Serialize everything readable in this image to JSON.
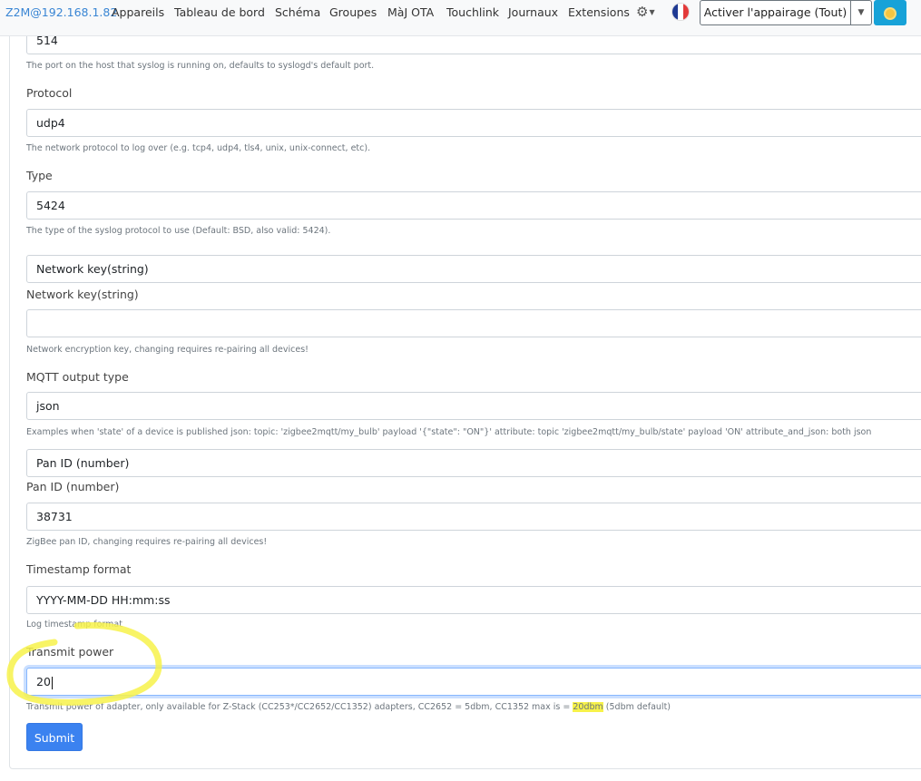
{
  "navbar": {
    "brand": "Z2M@192.168.1.82",
    "links": [
      "Appareils",
      "Tableau de bord",
      "Schéma",
      "Groupes",
      "MàJ OTA",
      "Touchlink",
      "Journaux",
      "Extensions"
    ],
    "pairing_button": "Activer l'appairage (Tout)",
    "flag_colors": [
      "#1f3a93",
      "#ffffff",
      "#e33a3a"
    ],
    "settings_icon": "gear-icon",
    "theme_icon": "sun-icon"
  },
  "form": {
    "port": {
      "value": "514",
      "help": "The port on the host that syslog is running on, defaults to syslogd's default port."
    },
    "protocol": {
      "label": "Protocol",
      "value": "udp4",
      "help": "The network protocol to log over (e.g. tcp4, udp4, tls4, unix, unix-connect, etc)."
    },
    "type": {
      "label": "Type",
      "value": "5424",
      "help": "The type of the syslog protocol to use (Default: BSD, also valid: 5424)."
    },
    "network_key": {
      "selector": "Network key(string)",
      "label": "Network key(string)",
      "value": "",
      "help": "Network encryption key, changing requires re-pairing all devices!"
    },
    "mqtt_output": {
      "label": "MQTT output type",
      "value": "json",
      "help": "Examples when 'state' of a device is published json: topic: 'zigbee2mqtt/my_bulb' payload '{\"state\": \"ON\"}' attribute: topic 'zigbee2mqtt/my_bulb/state' payload 'ON' attribute_and_json: both json"
    },
    "pan_id": {
      "selector": "Pan ID (number)",
      "label": "Pan ID (number)",
      "value": "38731",
      "help": "ZigBee pan ID, changing requires re-pairing all devices!"
    },
    "timestamp": {
      "label": "Timestamp format",
      "value": "YYYY-MM-DD HH:mm:ss",
      "help": "Log timestamp format"
    },
    "transmit_power": {
      "label": "Transmit power",
      "value": "20",
      "help_prefix": "Transmit power of adapter, only available for Z-Stack (CC253*/CC2652/CC1352) adapters, CC2652 = 5dbm, CC1352 max is = ",
      "help_highlight": "20dbm",
      "help_suffix": " (5dbm default)"
    },
    "submit": "Submit"
  },
  "annotation": {
    "color": "#f7f24a"
  }
}
